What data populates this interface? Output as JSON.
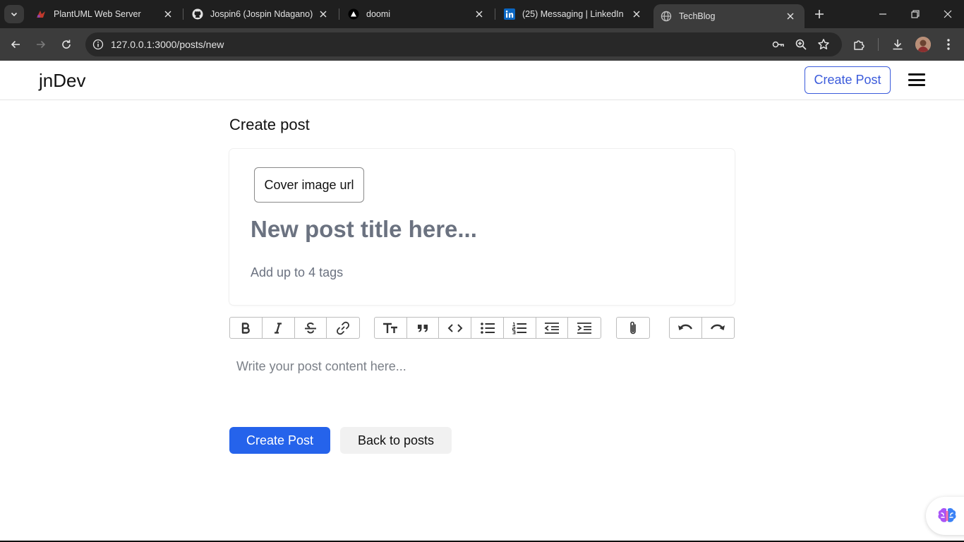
{
  "browser": {
    "tabs": [
      {
        "title": "PlantUML Web Server",
        "icon": "plantuml-icon"
      },
      {
        "title": "Jospin6 (Jospin Ndagano)",
        "icon": "github-icon"
      },
      {
        "title": "doomi",
        "icon": "vercel-triangle-icon"
      },
      {
        "title": "(25) Messaging | LinkedIn",
        "icon": "linkedin-icon"
      },
      {
        "title": "TechBlog",
        "icon": "globe-icon",
        "active": true
      }
    ],
    "address": {
      "host": "127.0.0.1",
      "rest": ":3000/posts/new"
    }
  },
  "site": {
    "logo": "jnDev",
    "header_create_label": "Create Post"
  },
  "form": {
    "heading": "Create post",
    "cover_label": "Cover image url",
    "title_placeholder": "New post title here...",
    "tags_placeholder": "Add up to 4 tags",
    "content_placeholder": "Write your post content here...",
    "submit_label": "Create Post",
    "back_label": "Back to posts"
  },
  "editor_toolbar": {
    "groups": [
      [
        "bold-icon",
        "italic-icon",
        "strikethrough-icon",
        "link-icon"
      ],
      [
        "heading-icon",
        "quote-icon",
        "code-icon",
        "bullet-list-icon",
        "numbered-list-icon",
        "outdent-icon",
        "indent-icon"
      ],
      [
        "attach-icon"
      ],
      [
        "undo-icon",
        "redo-icon"
      ]
    ]
  },
  "colors": {
    "accent": "#2563eb",
    "outline_accent": "#3b5bdb",
    "placeholder": "#6b7280"
  }
}
